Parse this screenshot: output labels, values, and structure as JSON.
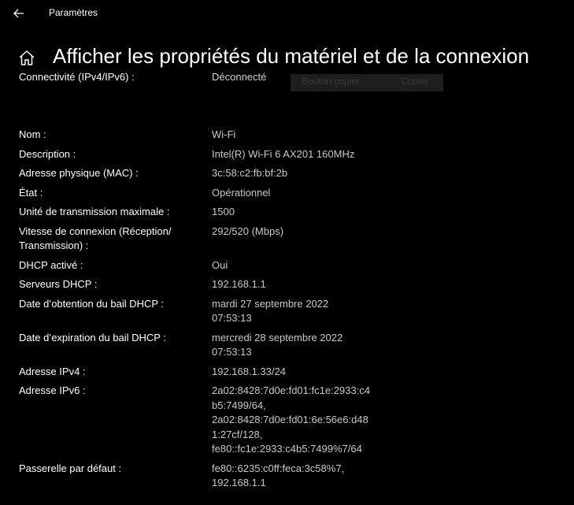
{
  "window": {
    "app_title": "Paramètres"
  },
  "header": {
    "title": "Afficher les propriétés du matériel et de la connexion"
  },
  "cutoff_row": {
    "label": "Connectivité (IPv4/IPv6) :",
    "value": "Déconnecté",
    "ghost_button_1": "Bouton copier",
    "ghost_button_2": "Copier"
  },
  "properties": [
    {
      "label": "Nom :",
      "value": "Wi-Fi"
    },
    {
      "label": "Description :",
      "value": "Intel(R) Wi-Fi 6 AX201 160MHz"
    },
    {
      "label": "Adresse physique (MAC) :",
      "value": "3c:58:c2:fb:bf:2b"
    },
    {
      "label": "État :",
      "value": "Opérationnel"
    },
    {
      "label": "Unité de transmission maximale :",
      "value": "1500"
    },
    {
      "label": "Vitesse de connexion (Réception/\nTransmission) :",
      "value": "292/520 (Mbps)"
    },
    {
      "label": "DHCP activé :",
      "value": "Oui"
    },
    {
      "label": "Serveurs DHCP :",
      "value": "192.168.1.1"
    },
    {
      "label": "Date d’obtention du bail DHCP :",
      "value": "mardi 27 septembre 2022\n07:53:13"
    },
    {
      "label": "Date d’expiration du bail DHCP :",
      "value": "mercredi 28 septembre 2022\n07:53:13"
    },
    {
      "label": "Adresse IPv4 :",
      "value": "192.168.1.33/24"
    },
    {
      "label": "Adresse IPv6 :",
      "value": "2a02:8428:7d0e:fd01:fc1e:2933:c4\nb5:7499/64,\n2a02:8428:7d0e:fd01:6e:56e6:d48\n1:27cf/128,\nfe80::fc1e:2933:c4b5:7499%7/64"
    },
    {
      "label": "Passerelle par défaut :",
      "value": "fe80::6235:c0ff:feca:3c58%7,\n192.168.1.1"
    }
  ],
  "colors": {
    "background": "#000000",
    "label_text": "#ffffff",
    "value_text": "#c8c8c8"
  },
  "icons": {
    "back": "back-arrow-icon",
    "home": "home-icon"
  }
}
